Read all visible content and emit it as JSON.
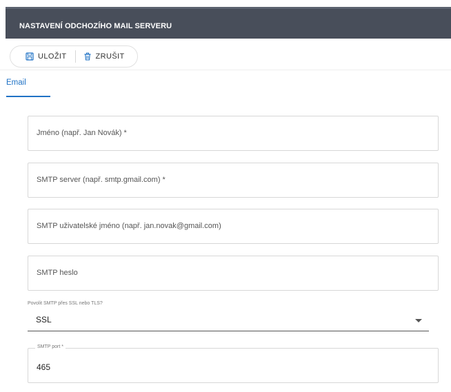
{
  "header": {
    "title": "NASTAVENÍ ODCHOZÍHO MAIL SERVERU"
  },
  "toolbar": {
    "save_label": "ULOŽIT",
    "cancel_label": "ZRUŠIT",
    "save_icon": "save-icon",
    "cancel_icon": "trash-icon"
  },
  "tabs": [
    {
      "label": "Email",
      "active": true
    }
  ],
  "form": {
    "name_label": "Jméno (např. Jan Novák) *",
    "smtp_server_label": "SMTP server (např. smtp.gmail.com) *",
    "smtp_user_label": "SMTP uživatelské jméno (např. jan.novak@gmail.com)",
    "smtp_password_label": "SMTP heslo",
    "ssl_label": "Povolit SMTP přes SSL nebo TLS?",
    "ssl_value": "SSL",
    "port_label": "SMTP port *",
    "port_value": "465"
  },
  "colors": {
    "header_bg": "#484e5a",
    "accent": "#1f72c5",
    "icon": "#1f72c5"
  }
}
